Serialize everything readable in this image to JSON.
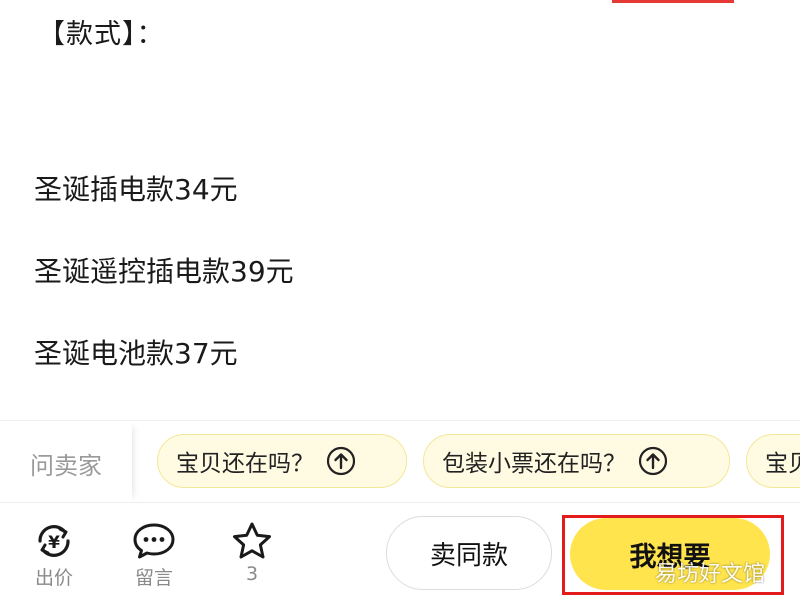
{
  "content": {
    "section_title": "【款式】：",
    "lines": [
      "圣诞插电款34元",
      "圣诞遥控插电款39元",
      "圣诞电池款37元",
      "…"
    ]
  },
  "quick_questions": {
    "ask_label": "问卖家",
    "chips": [
      "宝贝还在吗？",
      "包装小票还在吗？",
      "宝贝"
    ]
  },
  "bottom_bar": {
    "offer_label": "出价",
    "comment_label": "留言",
    "favorite_count": "3",
    "sell_same_label": "卖同款",
    "want_label": "我想要"
  },
  "watermark": "易坊好文馆",
  "colors": {
    "want_button": "#ffe44d",
    "chip_bg": "#fffbe3",
    "highlight_red": "#e31b1b"
  }
}
